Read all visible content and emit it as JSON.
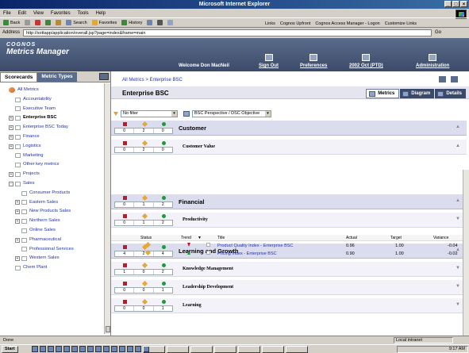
{
  "window": {
    "title": "Microsoft Internet Explorer"
  },
  "menu": [
    "File",
    "Edit",
    "View",
    "Favorites",
    "Tools",
    "Help"
  ],
  "toolbar": {
    "back": "Back",
    "search": "Search",
    "favorites": "Favorites",
    "history": "History",
    "links": [
      "Links",
      "Cognos Upfront",
      "Cognos Access Manager - Logon",
      "Customize Links"
    ]
  },
  "address": {
    "label": "Address",
    "url": "http://sottapp/application/overall.jsp?page=index&frame=main",
    "go": "Go"
  },
  "header": {
    "logo_top": "COGNOS",
    "logo_bottom": "Metrics Manager",
    "welcome": "Welcome Don MacNeil",
    "links": [
      {
        "label": "Sign Out"
      },
      {
        "label": "Preferences"
      },
      {
        "label": "2002 Oct (PTD)"
      },
      {
        "label": "Administration"
      }
    ]
  },
  "left_panel": {
    "tabs": [
      "Scorecards",
      "Metric Types"
    ],
    "tree": [
      {
        "label": "All Metrics",
        "level": 0,
        "expander": "",
        "root": true
      },
      {
        "label": "Accountability",
        "level": 1,
        "expander": ""
      },
      {
        "label": "Executive Team",
        "level": 1,
        "expander": ""
      },
      {
        "label": "Enterprise BSC",
        "level": 1,
        "expander": "+",
        "bold": true
      },
      {
        "label": "Enterprise BSC Today",
        "level": 1,
        "expander": "+"
      },
      {
        "label": "Finance",
        "level": 1,
        "expander": "+"
      },
      {
        "label": "Logistics",
        "level": 1,
        "expander": "+"
      },
      {
        "label": "Marketing",
        "level": 1,
        "expander": ""
      },
      {
        "label": "Other key metrics",
        "level": 1,
        "expander": ""
      },
      {
        "label": "Projects",
        "level": 1,
        "expander": "+"
      },
      {
        "label": "Sales",
        "level": 1,
        "expander": "-"
      },
      {
        "label": "Consumer Products",
        "level": 2,
        "expander": ""
      },
      {
        "label": "Eastern Sales",
        "level": 2,
        "expander": "+"
      },
      {
        "label": "New Products Sales",
        "level": 2,
        "expander": "+"
      },
      {
        "label": "Northern Sales",
        "level": 2,
        "expander": "+"
      },
      {
        "label": "Online Sales",
        "level": 2,
        "expander": ""
      },
      {
        "label": "Pharmaceutical",
        "level": 2,
        "expander": "+"
      },
      {
        "label": "Professional Services",
        "level": 2,
        "expander": ""
      },
      {
        "label": "Western Sales",
        "level": 2,
        "expander": "+"
      },
      {
        "label": "Chem Plant",
        "level": 1,
        "expander": ""
      }
    ]
  },
  "main": {
    "breadcrumb": "All Metrics > Enterprise BSC",
    "page_title": "Enterprise BSC",
    "view_tabs": [
      "Metrics",
      "Diagram",
      "Details"
    ],
    "filter": "No filter",
    "perspective": "BSC Perspective / DSC Objective",
    "sections": [
      {
        "title": "Customer",
        "counts": [
          "0",
          "2",
          "0"
        ],
        "kind": "section",
        "arrow": "▲"
      },
      {
        "title": "Customer Value",
        "counts": [
          "0",
          "2",
          "0"
        ],
        "kind": "sub",
        "arrow": "▲"
      },
      {
        "title": "Financial",
        "counts": [
          "0",
          "1",
          "2"
        ],
        "kind": "section",
        "arrow": "▲"
      },
      {
        "title": "Productivity",
        "counts": [
          "0",
          "1",
          "2"
        ],
        "kind": "sub",
        "arrow": "▼"
      },
      {
        "title": "Learning and Growth",
        "counts": [
          "4",
          "2",
          "4"
        ],
        "kind": "section",
        "arrow": "▲"
      },
      {
        "title": "Knowledge Management",
        "counts": [
          "1",
          "0",
          "2"
        ],
        "kind": "sub",
        "arrow": "▼"
      },
      {
        "title": "Leadership Development",
        "counts": [
          "0",
          "0",
          "1"
        ],
        "kind": "sub",
        "arrow": "▼"
      },
      {
        "title": "Learning",
        "counts": [
          "0",
          "0",
          "1"
        ],
        "kind": "sub",
        "arrow": "▼"
      }
    ],
    "metrics_table": {
      "headers": [
        "Status",
        "Trend",
        "Title",
        "Actual",
        "Target",
        "Variance"
      ],
      "rows": [
        {
          "trend": "down",
          "title": "Product Quality Index - Enterprise BSC",
          "actual": "0.96",
          "target": "1.00",
          "variance": "-0.04"
        },
        {
          "trend": "up",
          "title": "Pricing Index - Enterprise BSC",
          "actual": "0.90",
          "target": "1.00",
          "variance": "-0.02"
        }
      ]
    }
  },
  "statusbar": {
    "text": "Done",
    "zone": "Local intranet"
  },
  "taskbar": {
    "start": "Start",
    "clock": "9:17 AM"
  },
  "colors": {
    "red": "#b91d2a",
    "yellow": "#e2a83a",
    "green": "#1e9a3b",
    "header": "#3b4a68",
    "section": "#dcdcef"
  }
}
